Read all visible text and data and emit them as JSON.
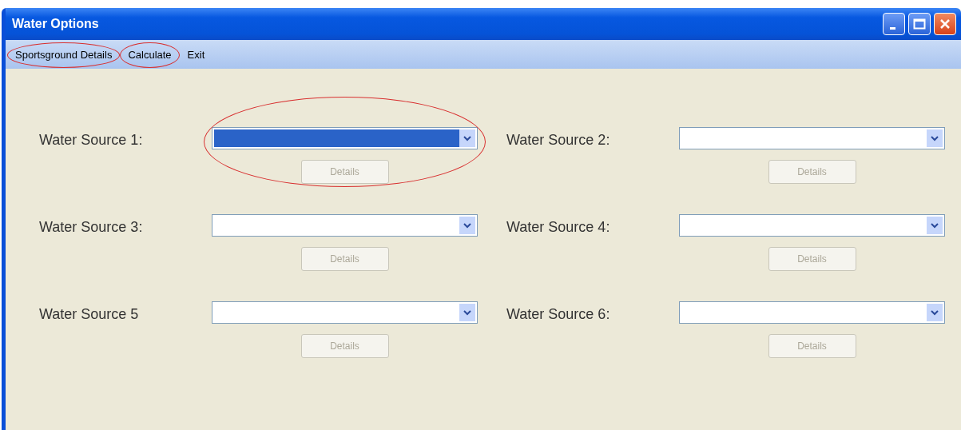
{
  "window": {
    "title": "Water Options"
  },
  "menu": [
    {
      "label": "Sportsground Details",
      "circled": true
    },
    {
      "label": "Calculate",
      "circled": true
    },
    {
      "label": "Exit",
      "circled": false
    }
  ],
  "sources": [
    {
      "label": "Water Source 1:",
      "focused": true,
      "circled": true,
      "button": {
        "label": "Details",
        "disabled": true
      }
    },
    {
      "label": "Water Source 2:",
      "focused": false,
      "circled": false,
      "button": {
        "label": "Details",
        "disabled": true
      }
    },
    {
      "label": "Water Source 3:",
      "focused": false,
      "circled": false,
      "button": {
        "label": "Details",
        "disabled": true
      }
    },
    {
      "label": "Water Source 4:",
      "focused": false,
      "circled": false,
      "button": {
        "label": "Details",
        "disabled": true
      }
    },
    {
      "label": "Water Source 5",
      "focused": false,
      "circled": false,
      "button": {
        "label": "Details",
        "disabled": true
      }
    },
    {
      "label": "Water Source 6:",
      "focused": false,
      "circled": false,
      "button": {
        "label": "Details",
        "disabled": true
      }
    }
  ]
}
